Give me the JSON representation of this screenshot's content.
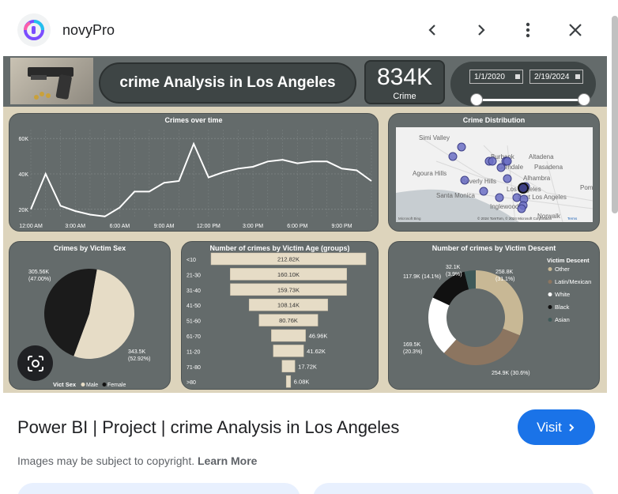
{
  "topbar": {
    "site_name": "novyPro",
    "logo_icon": "novypro-logo-icon",
    "prev_icon": "chevron-left-icon",
    "next_icon": "chevron-right-icon",
    "more_icon": "more-vert-icon",
    "close_icon": "close-icon"
  },
  "dashboard": {
    "title": "crime Analysis in Los Angeles",
    "kpi_value": "834K",
    "kpi_label": "Crime",
    "date_start": "1/1/2020",
    "date_end": "2/19/2024",
    "colors": {
      "background": "#ddd4bc",
      "card": "#646b6b",
      "pill": "#3e4545",
      "beige": "#e6dcc6"
    }
  },
  "chart_data": [
    {
      "type": "line",
      "title": "Crimes over time",
      "x_ticks": [
        "12:00 AM",
        "3:00 AM",
        "6:00 AM",
        "9:00 AM",
        "12:00 PM",
        "3:00 PM",
        "6:00 PM",
        "9:00 PM"
      ],
      "y_ticks": [
        "20K",
        "40K",
        "60K"
      ],
      "ylim": [
        15000,
        65000
      ],
      "x": [
        0,
        1,
        2,
        3,
        4,
        5,
        6,
        7,
        8,
        9,
        10,
        11,
        12,
        13,
        14,
        15,
        16,
        17,
        18,
        19,
        20,
        21,
        22,
        23
      ],
      "values": [
        20000,
        40000,
        22000,
        19000,
        17000,
        16000,
        21000,
        30000,
        30000,
        35000,
        36000,
        57000,
        38000,
        41000,
        43000,
        44000,
        47000,
        48000,
        46000,
        47000,
        47000,
        43000,
        42000,
        36000
      ]
    },
    {
      "type": "map",
      "title": "Crime Distribution",
      "place_labels": [
        "Simi Valley",
        "Burbank",
        "Altadena",
        "Glendale",
        "Pasadena",
        "Agoura Hills",
        "Alhambra",
        "Beverly Hills",
        "Los Angeles",
        "Santa Monica",
        "East Los Angeles",
        "Inglewood",
        "Pom",
        "Norwalk"
      ],
      "attribution": "© 2024 TomTom, © 2024 Microsoft Corporation",
      "terms": "Terms",
      "brand": "Microsoft Bing"
    },
    {
      "type": "pie",
      "title": "Crimes by Victim Sex",
      "legend_title": "Vict Sex",
      "labels": [
        "Male",
        "Female"
      ],
      "values": [
        305.56,
        343.5
      ],
      "value_labels": [
        "305.56K\n(47.00%)",
        "343.5K\n(52.92%)"
      ],
      "colors": [
        "#1b1b1b",
        "#e6dcc6"
      ]
    },
    {
      "type": "bar",
      "title": "Number of crimes by Victim Age (groups)",
      "categories": [
        "<10",
        "21-30",
        "31-40",
        "41-50",
        "51-60",
        "61-70",
        "11-20",
        "71-80",
        ">80"
      ],
      "values": [
        212.82,
        160.1,
        159.73,
        108.14,
        80.76,
        46.96,
        41.62,
        17.72,
        6.08
      ],
      "value_labels": [
        "212.82K",
        "160.10K",
        "159.73K",
        "108.14K",
        "80.76K",
        "46.96K",
        "41.62K",
        "17.72K",
        "6.08K"
      ]
    },
    {
      "type": "pie",
      "title": "Number of crimes by Victim Descent",
      "legend_title": "Victim Descent",
      "labels": [
        "Other",
        "Latin/Mexican",
        "White",
        "Black",
        "Asian"
      ],
      "values": [
        258.8,
        254.9,
        169.5,
        117.9,
        32.1
      ],
      "value_labels": [
        "258.8K\n(31.1%)",
        "254.9K (30.6%)",
        "169.5K\n(20.3%)",
        "117.9K (14.1%)",
        "32.1K\n(3.9%)"
      ],
      "colors": [
        "#c8b895",
        "#8c7560",
        "#ffffff",
        "#111111",
        "#3f5a59"
      ]
    }
  ],
  "result": {
    "title": "Power BI | Project | crime Analysis in Los Angeles",
    "visit_label": "Visit",
    "copyright_text": "Images may be subject to copyright.",
    "learn_more": "Learn More"
  }
}
